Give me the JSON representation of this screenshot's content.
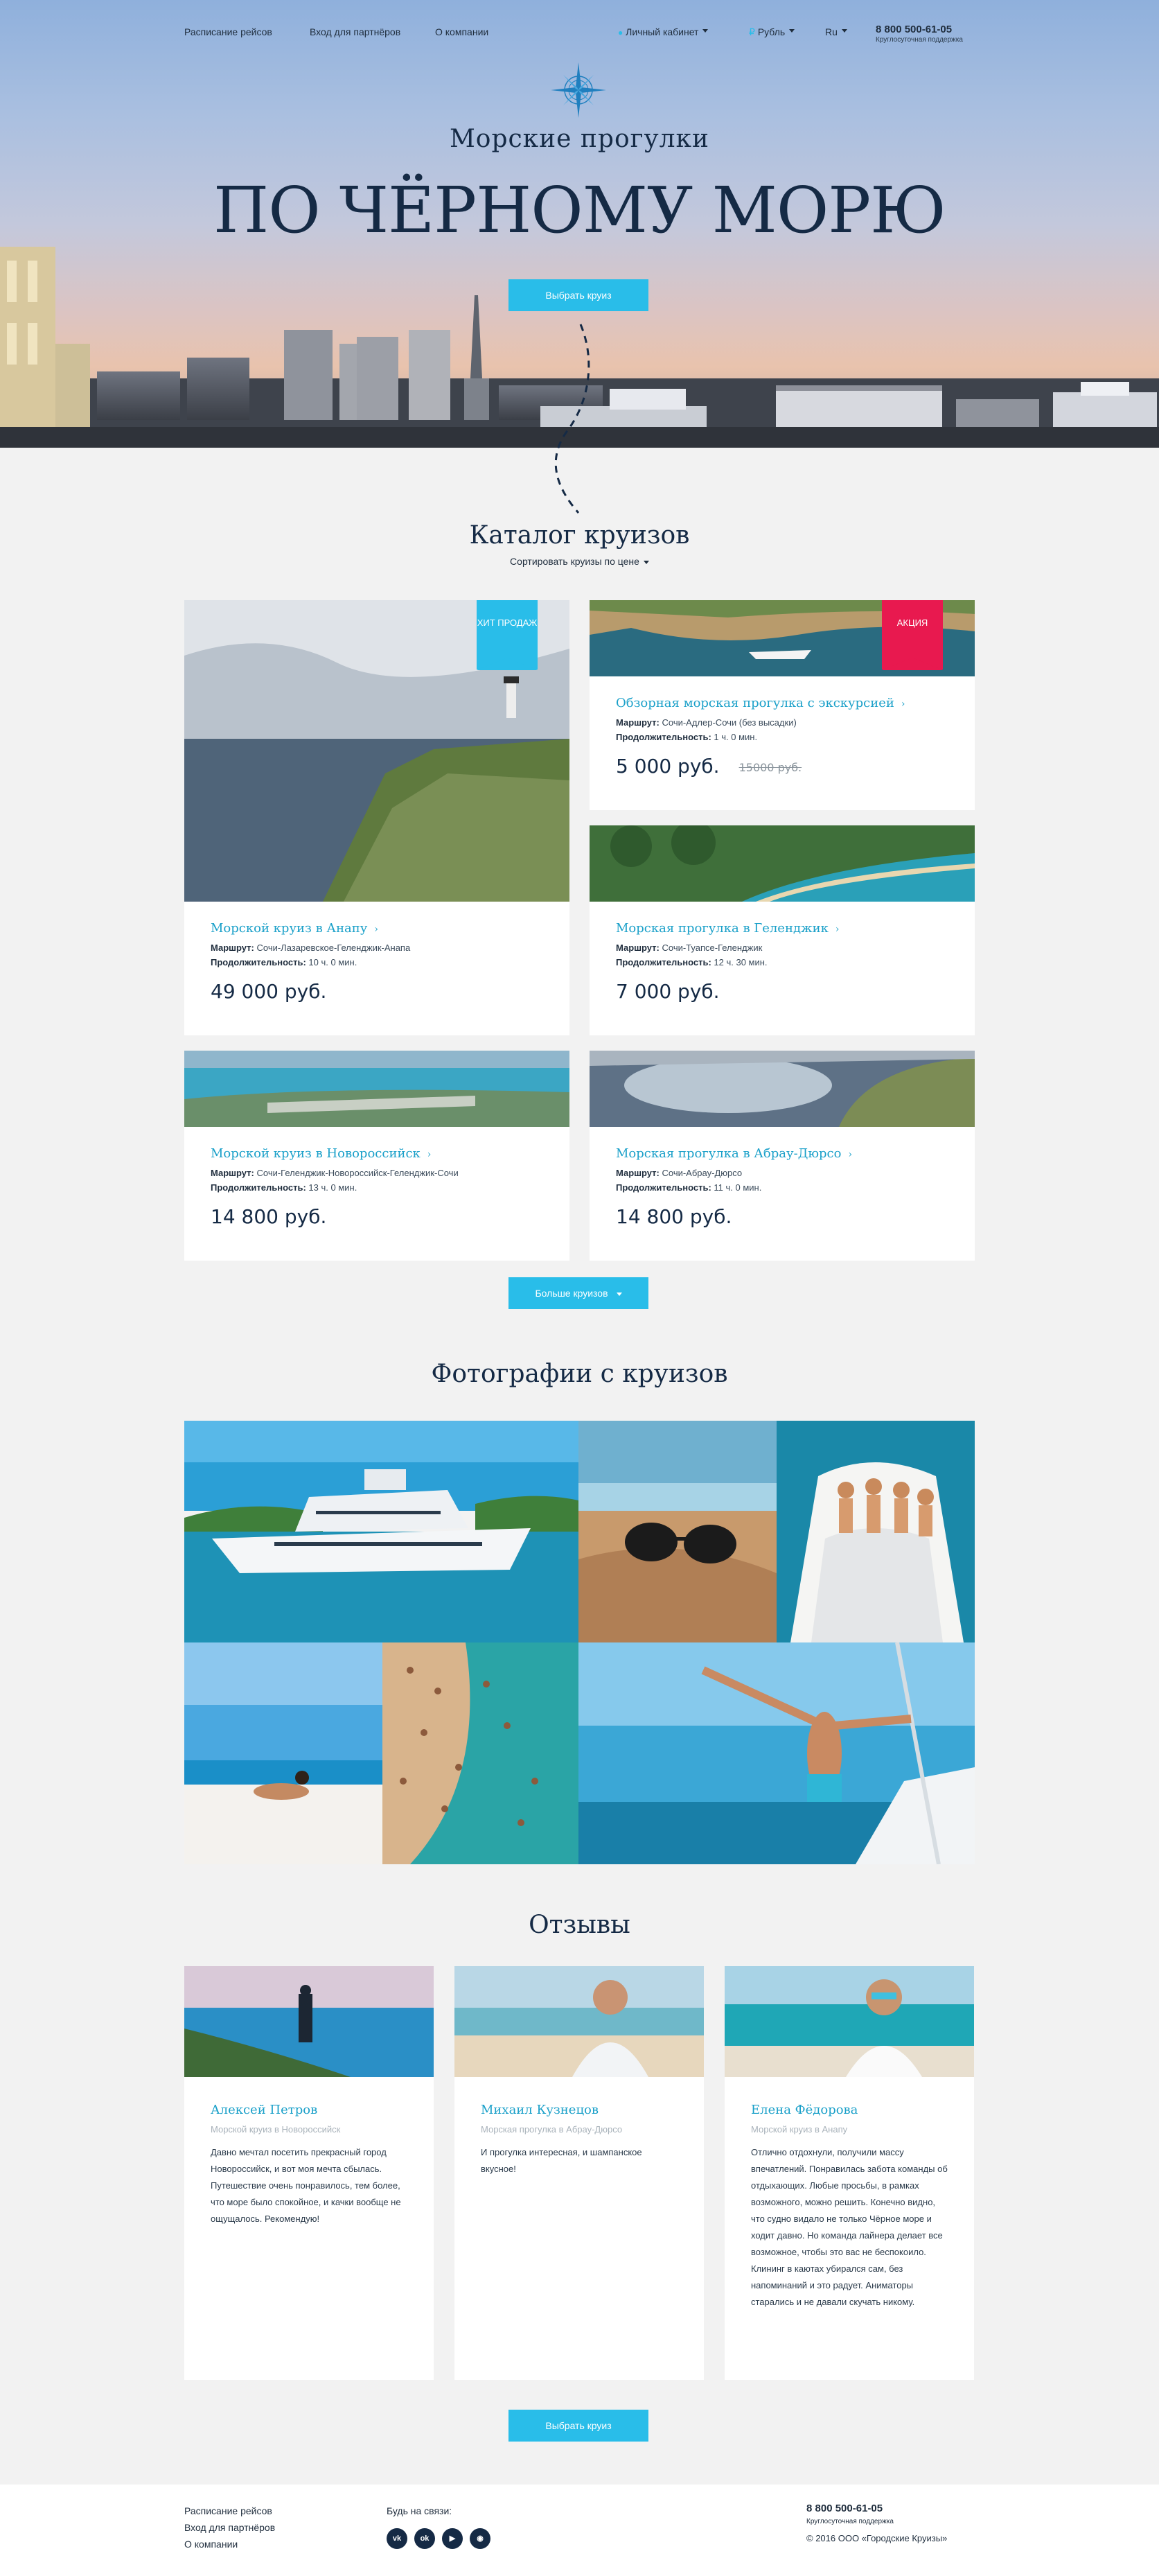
{
  "header": {
    "nav": [
      "Расписание рейсов",
      "Вход для партнёров",
      "О компании"
    ],
    "account": "Личный кабинет",
    "currency": "Рубль",
    "language": "Ru",
    "phone": "8 800 500-61-05",
    "phone_note": "Круглосуточная поддержка"
  },
  "hero": {
    "subtitle": "Морские прогулки",
    "title": "ПО ЧЁРНОМУ МОРЮ",
    "button": "Выбрать круиз"
  },
  "catalog": {
    "title": "Каталог круизов",
    "sort": "Сортировать круизы по цене",
    "route_label": "Маршрут:",
    "duration_label": "Продолжительность:",
    "cruises": [
      {
        "name": "Морской круиз в Анапу",
        "route": "Сочи-Лазаревское-Геленджик-Анапа",
        "duration": "10 ч. 0 мин.",
        "price": "49 000 руб.",
        "badge": "ХИТ ПРОДАЖ"
      },
      {
        "name": "Обзорная морская прогулка с экскурсией",
        "route": "Сочи-Адлер-Сочи (без высадки)",
        "duration": "1 ч. 0 мин.",
        "price": "5 000 руб.",
        "old_price": "15000 руб.",
        "badge": "АКЦИЯ"
      },
      {
        "name": "Морская прогулка в Геленджик",
        "route": "Сочи-Туапсе-Геленджик",
        "duration": "12 ч. 30 мин.",
        "price": "7 000 руб."
      },
      {
        "name": "Морской круиз в Новороссийск",
        "route": "Сочи-Геленджик-Новороссийск-Геленджик-Сочи",
        "duration": "13 ч. 0 мин.",
        "price": "14 800 руб."
      },
      {
        "name": "Морская прогулка в Абрау-Дюрсо",
        "route": "Сочи-Абрау-Дюрсо",
        "duration": "11 ч. 0 мин.",
        "price": "14 800 руб."
      }
    ],
    "more_button": "Больше круизов"
  },
  "photos": {
    "title": "Фотографии с круизов"
  },
  "reviews": {
    "title": "Отзывы",
    "items": [
      {
        "name": "Алексей Петров",
        "cruise": "Морской круиз в Новороссийск",
        "text": "Давно мечтал посетить прекрасный город Новороссийск, и вот моя мечта сбылась. Путешествие очень понравилось, тем более, что море было спокойное, и качки вообще не ощущалось. Рекомендую!"
      },
      {
        "name": "Михаил Кузнецов",
        "cruise": "Морская прогулка в Абрау-Дюрсо",
        "text": "И прогулка интересная, и шампанское вкусное!"
      },
      {
        "name": "Елена Фёдорова",
        "cruise": "Морской круиз в Анапу",
        "text": "Отлично отдохнули, получили массу впечатлений. Понравилась забота команды об отдыхающих. Любые просьбы, в рамках возможного, можно решить. Конечно видно, что судно видало не только Чёрное море и ходит давно. Но команда лайнера делает все возможное, чтобы это вас не беспокоило. Клининг в каютах убирался сам, без напоминаний и это радует. Аниматоры старались и не давали скучать никому."
      }
    ],
    "button": "Выбрать круиз"
  },
  "footer": {
    "links": [
      "Расписание рейсов",
      "Вход для партнёров",
      "О компании"
    ],
    "social_label": "Будь на связи:",
    "social": [
      "vk",
      "ok",
      "yt",
      "ig"
    ],
    "phone": "8 800 500-61-05",
    "phone_note": "Круглосуточная поддержка",
    "copyright": "© 2016 ООО «Городские Круизы»"
  },
  "colors": {
    "accent": "#29bde9",
    "link": "#1aa0c9",
    "sale": "#e8194f",
    "dark": "#152a45"
  }
}
